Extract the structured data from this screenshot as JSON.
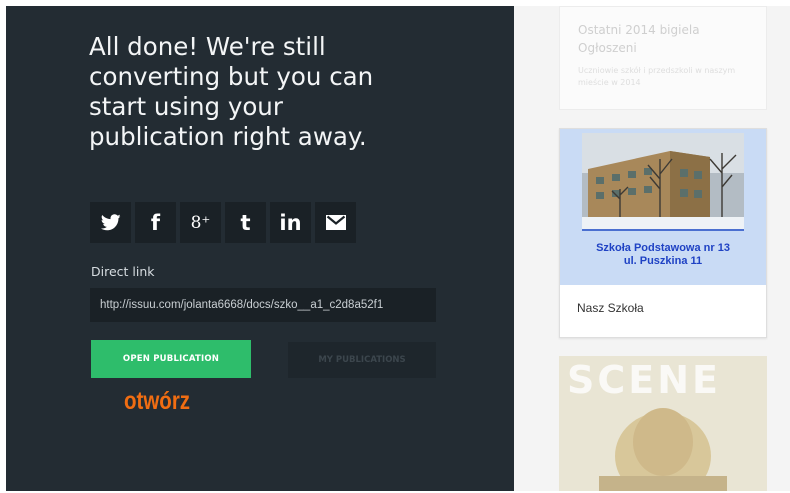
{
  "dialog": {
    "headline": "All done! We're still converting but you can start using your publication right away.",
    "share_buttons": [
      {
        "icon": "twitter-icon",
        "glyph": ""
      },
      {
        "icon": "facebook-icon",
        "glyph": "f"
      },
      {
        "icon": "google-plus-icon",
        "glyph": "8⁺"
      },
      {
        "icon": "tumblr-icon",
        "glyph": "t"
      },
      {
        "icon": "linkedin-icon",
        "glyph": "in"
      },
      {
        "icon": "email-icon",
        "glyph": ""
      }
    ],
    "direct_link_label": "Direct link",
    "direct_link_value": "http://issuu.com/jolanta6668/docs/szko__a1_c2d8a52f1",
    "open_publication_label": "OPEN PUBLICATION",
    "my_publications_label": "MY PUBLICATIONS"
  },
  "annotation": "otwórz",
  "backdrop": {
    "card_top": {
      "title": "Ostatni 2014 bigiela Ogłoszeni",
      "text": "Uczniowie szkół i przedszkoli w naszym mieście w 2014"
    },
    "card_main": {
      "thumbnail_title": "Szkoła Podstawowa nr 13\nul. Puszkina 11",
      "caption": "Nasz Szkoła"
    },
    "card_bottom": {
      "cover_word": "SCENE"
    }
  },
  "colors": {
    "panel_bg": "#232c33",
    "share_bg": "#1a2126",
    "primary_green": "#2ebd6b",
    "annotation_orange": "#f06d12"
  }
}
